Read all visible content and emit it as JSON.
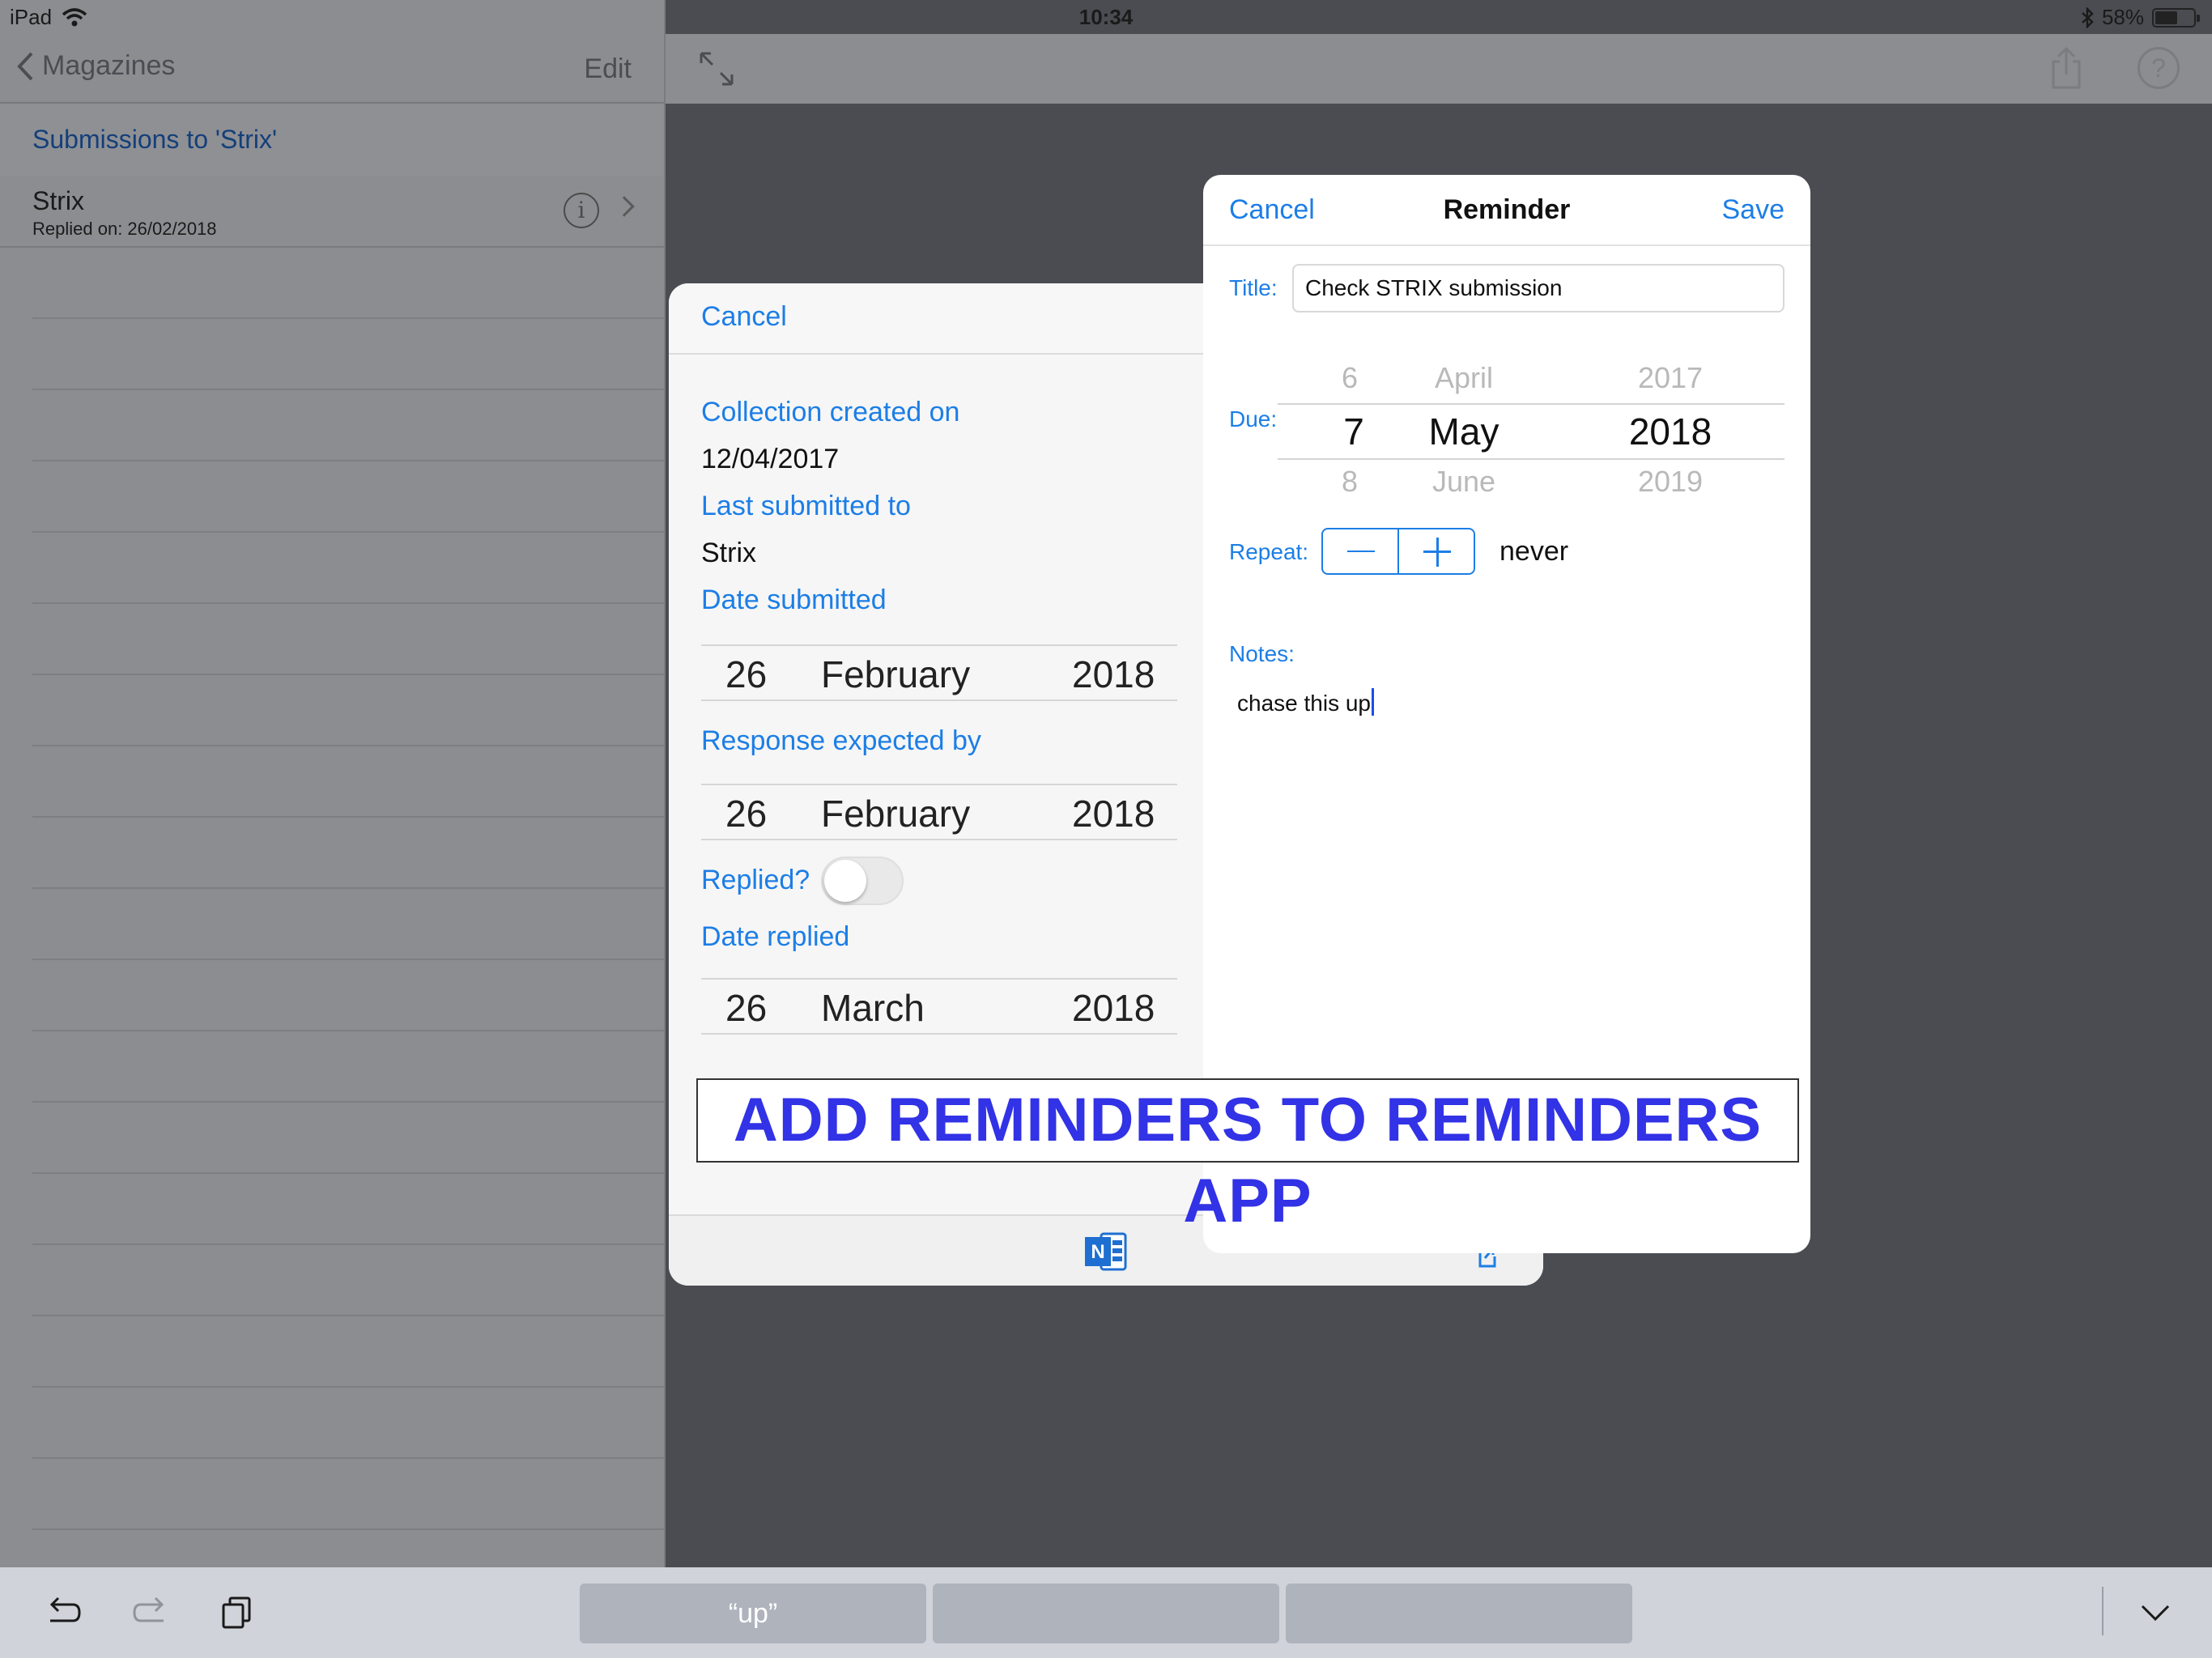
{
  "status_bar": {
    "device": "iPad",
    "time": "10:34",
    "battery_percent": "58%",
    "battery_level": 0.58
  },
  "master": {
    "back_label": "Magazines",
    "edit_label": "Edit",
    "section_title": "Submissions to 'Strix'",
    "items": [
      {
        "title": "Strix",
        "subtitle": "Replied on: 26/02/2018"
      }
    ]
  },
  "collection_popover": {
    "cancel_label": "Cancel",
    "collection_created_label": "Collection created on",
    "collection_created_value": "12/04/2017",
    "last_submitted_label": "Last submitted to",
    "last_submitted_value": "Strix",
    "date_submitted_label": "Date submitted",
    "date_submitted": {
      "day": "26",
      "month": "February",
      "year": "2018"
    },
    "response_expected_label": "Response expected by",
    "response_expected": {
      "day": "26",
      "month": "February",
      "year": "2018"
    },
    "replied_label": "Replied?",
    "replied_on": false,
    "date_replied_label": "Date replied",
    "date_replied": {
      "day": "26",
      "month": "March",
      "year": "2018"
    }
  },
  "reminder_popover": {
    "cancel_label": "Cancel",
    "title": "Reminder",
    "save_label": "Save",
    "title_label": "Title:",
    "title_value": "Check STRIX submission",
    "due_label": "Due:",
    "due_picker": {
      "prev": {
        "day": "6",
        "month": "April",
        "year": "2017"
      },
      "selected": {
        "day": "7",
        "month": "May",
        "year": "2018"
      },
      "next": {
        "day": "8",
        "month": "June",
        "year": "2019"
      }
    },
    "repeat_label": "Repeat:",
    "repeat_value": "never",
    "notes_label": "Notes:",
    "notes_value": "chase this up"
  },
  "banner": {
    "text": "ADD REMINDERS TO REMINDERS APP",
    "color": "#3232e6"
  },
  "keyboard_bar": {
    "suggestions": [
      "“up”",
      "",
      ""
    ]
  },
  "colors": {
    "accent": "#1c7ee6",
    "dim_overlay": "#4b4c52"
  }
}
